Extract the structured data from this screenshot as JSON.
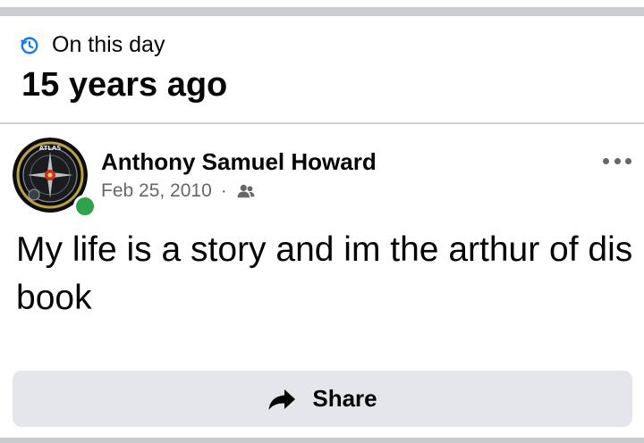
{
  "memory": {
    "label": "On this day",
    "title": "15 years ago",
    "clock_icon": "clock-icon",
    "accent_color": "#1877f2"
  },
  "post": {
    "author": "Anthony Samuel Howard",
    "date": "Feb 25, 2010",
    "separator": "·",
    "audience_icon": "friends-icon",
    "online_status_color": "#31a24c",
    "text": "My life is a story and im the arthur of dis book",
    "more_icon": "more-options-icon"
  },
  "actions": {
    "share_label": "Share",
    "share_icon": "share-arrow-icon"
  },
  "avatar_logo": {
    "text": "ATLAS"
  }
}
